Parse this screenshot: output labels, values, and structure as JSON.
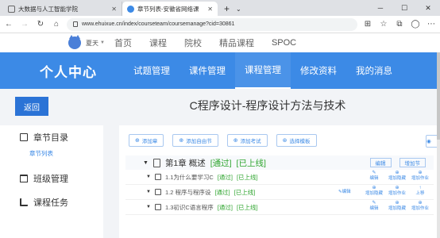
{
  "browser": {
    "tabs": [
      {
        "title": "大数据与人工智能学院",
        "active": false
      },
      {
        "title": "章节列表-安徽省网络课",
        "active": true
      }
    ],
    "url": "www.ehuixue.cn/index/courseteam/coursemanage?cid=30861"
  },
  "site": {
    "username": "夏天",
    "links": [
      "首页",
      "课程",
      "院校",
      "精品课程",
      "SPOC"
    ]
  },
  "header": {
    "center_title": "个人中心",
    "nav": [
      "试题管理",
      "课件管理",
      "课程管理",
      "修改资料",
      "我的消息"
    ],
    "active_nav": "课程管理"
  },
  "page": {
    "back_label": "返回",
    "course_title": "C程序设计-程序设计方法与技术"
  },
  "sidebar": {
    "chapter_dir": "章节目录",
    "chapter_list": "章节列表",
    "class_manage": "班级管理",
    "course_task": "课程任务"
  },
  "toolbar": [
    "添加章",
    "添加自由节",
    "添加考试",
    "选择模板"
  ],
  "chapter": {
    "title": "第1章 概述",
    "status1": "[通过]",
    "status2": "[已上线]",
    "edit": "编辑",
    "add_section": "增加节"
  },
  "sections": [
    {
      "title": "1.1为什么要学习C",
      "s1": "[通过]",
      "s2": "[已上线]",
      "acts": [
        "编辑",
        "增加隐藏",
        "增加作业"
      ]
    },
    {
      "title": "1.2 程序与程序设",
      "s1": "[通过]",
      "s2": "[已上线]",
      "acts": [
        "增加隐藏",
        "增加作业",
        "上移"
      ],
      "extra": "编辑"
    },
    {
      "title": "1.3初识C语言程序",
      "s1": "[通过]",
      "s2": "[已上线]",
      "acts": [
        "编辑",
        "增加隐藏",
        "增加作业"
      ]
    }
  ]
}
